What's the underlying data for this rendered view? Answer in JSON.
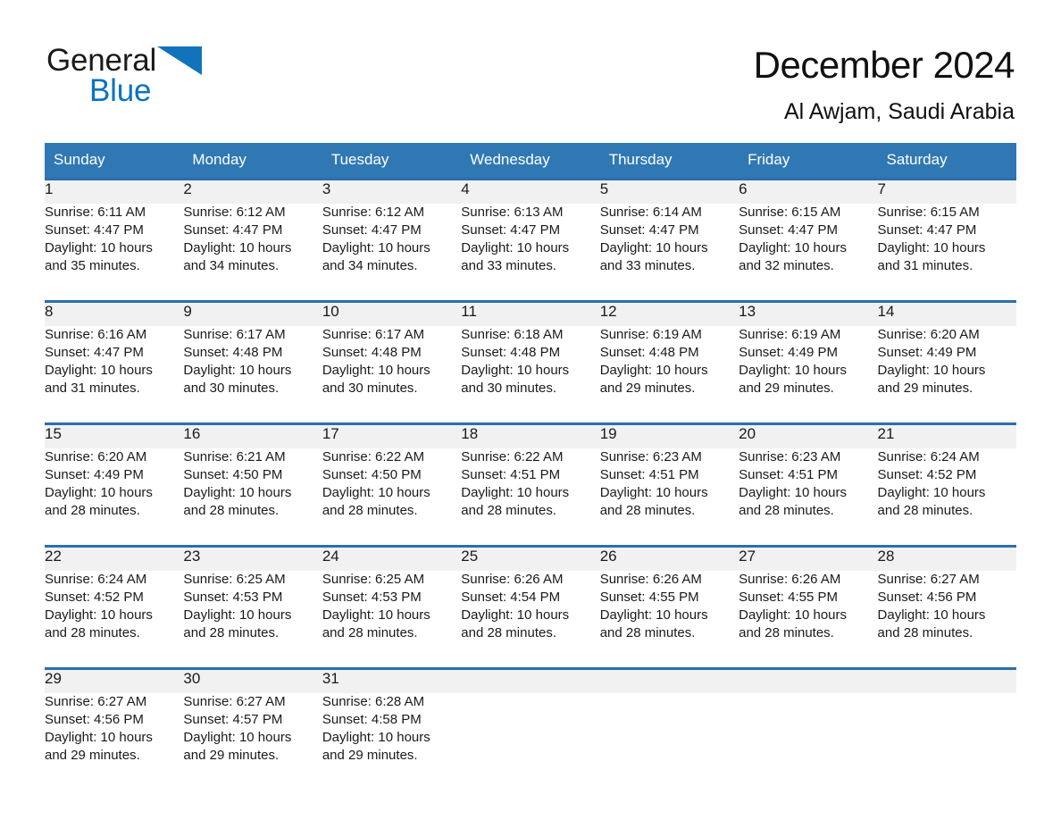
{
  "brand": {
    "name_part1": "General",
    "name_part2": "Blue",
    "triangle_color": "#1173ba",
    "blue_color": "#0b72c4"
  },
  "header": {
    "title": "December 2024",
    "subtitle": "Al Awjam, Saudi Arabia"
  },
  "theme": {
    "header_bg": "#3078b4",
    "rule_color": "#2a6fad",
    "daynum_bg": "#f1f1f1",
    "text_color": "#1a1a1a"
  },
  "calendar": {
    "weekday_headers": [
      "Sunday",
      "Monday",
      "Tuesday",
      "Wednesday",
      "Thursday",
      "Friday",
      "Saturday"
    ],
    "weeks": [
      [
        {
          "day": "1",
          "sunrise": "Sunrise: 6:11 AM",
          "sunset": "Sunset: 4:47 PM",
          "daylight_1": "Daylight: 10 hours",
          "daylight_2": "and 35 minutes."
        },
        {
          "day": "2",
          "sunrise": "Sunrise: 6:12 AM",
          "sunset": "Sunset: 4:47 PM",
          "daylight_1": "Daylight: 10 hours",
          "daylight_2": "and 34 minutes."
        },
        {
          "day": "3",
          "sunrise": "Sunrise: 6:12 AM",
          "sunset": "Sunset: 4:47 PM",
          "daylight_1": "Daylight: 10 hours",
          "daylight_2": "and 34 minutes."
        },
        {
          "day": "4",
          "sunrise": "Sunrise: 6:13 AM",
          "sunset": "Sunset: 4:47 PM",
          "daylight_1": "Daylight: 10 hours",
          "daylight_2": "and 33 minutes."
        },
        {
          "day": "5",
          "sunrise": "Sunrise: 6:14 AM",
          "sunset": "Sunset: 4:47 PM",
          "daylight_1": "Daylight: 10 hours",
          "daylight_2": "and 33 minutes."
        },
        {
          "day": "6",
          "sunrise": "Sunrise: 6:15 AM",
          "sunset": "Sunset: 4:47 PM",
          "daylight_1": "Daylight: 10 hours",
          "daylight_2": "and 32 minutes."
        },
        {
          "day": "7",
          "sunrise": "Sunrise: 6:15 AM",
          "sunset": "Sunset: 4:47 PM",
          "daylight_1": "Daylight: 10 hours",
          "daylight_2": "and 31 minutes."
        }
      ],
      [
        {
          "day": "8",
          "sunrise": "Sunrise: 6:16 AM",
          "sunset": "Sunset: 4:47 PM",
          "daylight_1": "Daylight: 10 hours",
          "daylight_2": "and 31 minutes."
        },
        {
          "day": "9",
          "sunrise": "Sunrise: 6:17 AM",
          "sunset": "Sunset: 4:48 PM",
          "daylight_1": "Daylight: 10 hours",
          "daylight_2": "and 30 minutes."
        },
        {
          "day": "10",
          "sunrise": "Sunrise: 6:17 AM",
          "sunset": "Sunset: 4:48 PM",
          "daylight_1": "Daylight: 10 hours",
          "daylight_2": "and 30 minutes."
        },
        {
          "day": "11",
          "sunrise": "Sunrise: 6:18 AM",
          "sunset": "Sunset: 4:48 PM",
          "daylight_1": "Daylight: 10 hours",
          "daylight_2": "and 30 minutes."
        },
        {
          "day": "12",
          "sunrise": "Sunrise: 6:19 AM",
          "sunset": "Sunset: 4:48 PM",
          "daylight_1": "Daylight: 10 hours",
          "daylight_2": "and 29 minutes."
        },
        {
          "day": "13",
          "sunrise": "Sunrise: 6:19 AM",
          "sunset": "Sunset: 4:49 PM",
          "daylight_1": "Daylight: 10 hours",
          "daylight_2": "and 29 minutes."
        },
        {
          "day": "14",
          "sunrise": "Sunrise: 6:20 AM",
          "sunset": "Sunset: 4:49 PM",
          "daylight_1": "Daylight: 10 hours",
          "daylight_2": "and 29 minutes."
        }
      ],
      [
        {
          "day": "15",
          "sunrise": "Sunrise: 6:20 AM",
          "sunset": "Sunset: 4:49 PM",
          "daylight_1": "Daylight: 10 hours",
          "daylight_2": "and 28 minutes."
        },
        {
          "day": "16",
          "sunrise": "Sunrise: 6:21 AM",
          "sunset": "Sunset: 4:50 PM",
          "daylight_1": "Daylight: 10 hours",
          "daylight_2": "and 28 minutes."
        },
        {
          "day": "17",
          "sunrise": "Sunrise: 6:22 AM",
          "sunset": "Sunset: 4:50 PM",
          "daylight_1": "Daylight: 10 hours",
          "daylight_2": "and 28 minutes."
        },
        {
          "day": "18",
          "sunrise": "Sunrise: 6:22 AM",
          "sunset": "Sunset: 4:51 PM",
          "daylight_1": "Daylight: 10 hours",
          "daylight_2": "and 28 minutes."
        },
        {
          "day": "19",
          "sunrise": "Sunrise: 6:23 AM",
          "sunset": "Sunset: 4:51 PM",
          "daylight_1": "Daylight: 10 hours",
          "daylight_2": "and 28 minutes."
        },
        {
          "day": "20",
          "sunrise": "Sunrise: 6:23 AM",
          "sunset": "Sunset: 4:51 PM",
          "daylight_1": "Daylight: 10 hours",
          "daylight_2": "and 28 minutes."
        },
        {
          "day": "21",
          "sunrise": "Sunrise: 6:24 AM",
          "sunset": "Sunset: 4:52 PM",
          "daylight_1": "Daylight: 10 hours",
          "daylight_2": "and 28 minutes."
        }
      ],
      [
        {
          "day": "22",
          "sunrise": "Sunrise: 6:24 AM",
          "sunset": "Sunset: 4:52 PM",
          "daylight_1": "Daylight: 10 hours",
          "daylight_2": "and 28 minutes."
        },
        {
          "day": "23",
          "sunrise": "Sunrise: 6:25 AM",
          "sunset": "Sunset: 4:53 PM",
          "daylight_1": "Daylight: 10 hours",
          "daylight_2": "and 28 minutes."
        },
        {
          "day": "24",
          "sunrise": "Sunrise: 6:25 AM",
          "sunset": "Sunset: 4:53 PM",
          "daylight_1": "Daylight: 10 hours",
          "daylight_2": "and 28 minutes."
        },
        {
          "day": "25",
          "sunrise": "Sunrise: 6:26 AM",
          "sunset": "Sunset: 4:54 PM",
          "daylight_1": "Daylight: 10 hours",
          "daylight_2": "and 28 minutes."
        },
        {
          "day": "26",
          "sunrise": "Sunrise: 6:26 AM",
          "sunset": "Sunset: 4:55 PM",
          "daylight_1": "Daylight: 10 hours",
          "daylight_2": "and 28 minutes."
        },
        {
          "day": "27",
          "sunrise": "Sunrise: 6:26 AM",
          "sunset": "Sunset: 4:55 PM",
          "daylight_1": "Daylight: 10 hours",
          "daylight_2": "and 28 minutes."
        },
        {
          "day": "28",
          "sunrise": "Sunrise: 6:27 AM",
          "sunset": "Sunset: 4:56 PM",
          "daylight_1": "Daylight: 10 hours",
          "daylight_2": "and 28 minutes."
        }
      ],
      [
        {
          "day": "29",
          "sunrise": "Sunrise: 6:27 AM",
          "sunset": "Sunset: 4:56 PM",
          "daylight_1": "Daylight: 10 hours",
          "daylight_2": "and 29 minutes."
        },
        {
          "day": "30",
          "sunrise": "Sunrise: 6:27 AM",
          "sunset": "Sunset: 4:57 PM",
          "daylight_1": "Daylight: 10 hours",
          "daylight_2": "and 29 minutes."
        },
        {
          "day": "31",
          "sunrise": "Sunrise: 6:28 AM",
          "sunset": "Sunset: 4:58 PM",
          "daylight_1": "Daylight: 10 hours",
          "daylight_2": "and 29 minutes."
        },
        {
          "day": "",
          "sunrise": "",
          "sunset": "",
          "daylight_1": "",
          "daylight_2": ""
        },
        {
          "day": "",
          "sunrise": "",
          "sunset": "",
          "daylight_1": "",
          "daylight_2": ""
        },
        {
          "day": "",
          "sunrise": "",
          "sunset": "",
          "daylight_1": "",
          "daylight_2": ""
        },
        {
          "day": "",
          "sunrise": "",
          "sunset": "",
          "daylight_1": "",
          "daylight_2": ""
        }
      ]
    ]
  }
}
